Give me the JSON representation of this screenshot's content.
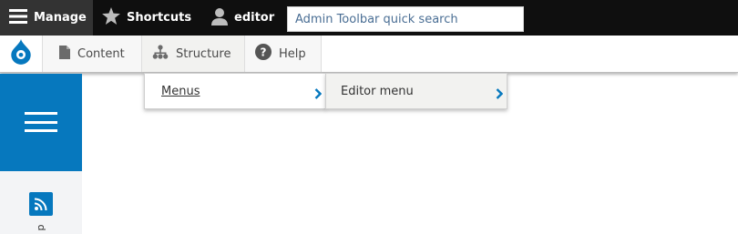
{
  "toolbar": {
    "manage_label": "Manage",
    "shortcuts_label": "Shortcuts",
    "user_label": "editor",
    "search_placeholder": "Admin Toolbar quick search"
  },
  "tray": {
    "items": [
      {
        "label": "Content",
        "icon": "document-icon"
      },
      {
        "label": "Structure",
        "icon": "sitemap-icon"
      },
      {
        "label": "Help",
        "icon": "question-circle-icon"
      }
    ],
    "logo_icon": "drupal-drop-icon"
  },
  "menus": {
    "level1": {
      "label": "Menus",
      "icon": "chevron-right-icon"
    },
    "level2": {
      "label": "Editor menu",
      "icon": "chevron-right-icon"
    }
  },
  "sidebar": {
    "toggle_icon": "hamburger-icon",
    "item_icon": "feed-icon",
    "item_letter": "p"
  },
  "colors": {
    "toolbar_bg": "#0f0f0f",
    "manage_bg": "#333333",
    "accent_blue": "#0678be",
    "chevron_blue": "#0678be",
    "placeholder_text": "#4a6e94"
  }
}
